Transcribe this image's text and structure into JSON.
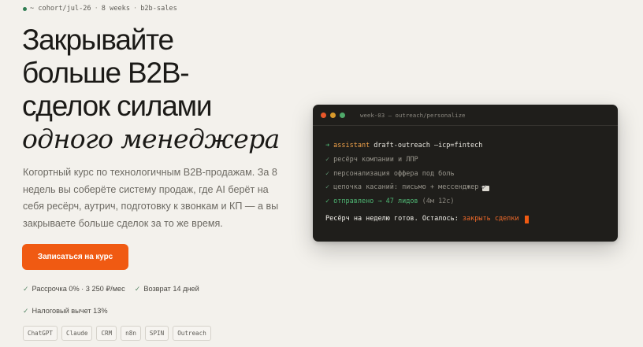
{
  "breadcrumb": {
    "cohort": "~ cohort/jul-26",
    "duration": "8 weeks",
    "track": "b2b-sales",
    "separator": "·"
  },
  "hero": {
    "title_line1": "Закрывайте",
    "title_line2": "больше B2B-",
    "title_line3": "сделок силами",
    "title_accent": "одного менеджера",
    "lead": "Когортный курс по технологичным B2B-продажам. За 8 недель вы соберёте систему продаж, где AI берёт на себя ресёрч, аутрич, подготовку к звонкам и КП — а вы закрываете больше сделок за то же время.",
    "cta_label": "Записаться на курс"
  },
  "perks": [
    "Рассрочка 0% · 3 250 ₽/мес",
    "Возврат 14 дней",
    "Налоговый вычет 13%"
  ],
  "tags": [
    "ChatGPT",
    "Claude",
    "CRM",
    "n8n",
    "SPIN",
    "Outreach"
  ],
  "terminal": {
    "title": "week-03 — outreach/personalize",
    "prompt_arrow": "➜",
    "command_name": "assistant",
    "command_args": "draft-outreach —icp=fintech",
    "steps": [
      "ресёрч компании и ЛПР",
      "персонализация оффера под боль",
      "цепочка касаний: письмо + мессенджер"
    ],
    "check": "✓",
    "sent_label": "отправлено → 47 лидов",
    "sent_time": "(4м 12с)",
    "final_text": "Ресёрч на неделю готов. Осталось:",
    "final_link": "закрыть сделки"
  },
  "colors": {
    "accent": "#f05a12",
    "success": "#4fb774",
    "terminal_bg": "#1f1e1b",
    "page_bg": "#f3f1ec"
  },
  "icons": {
    "status_dot": "status-dot-icon",
    "check": "check-icon",
    "mail": "mail-icon",
    "window_lights": [
      "close-light",
      "minimize-light",
      "maximize-light"
    ]
  }
}
